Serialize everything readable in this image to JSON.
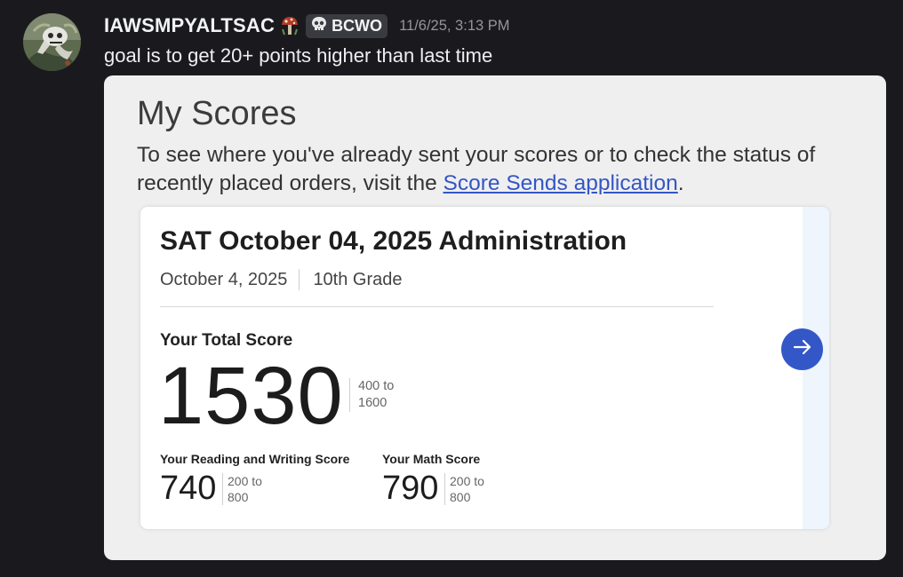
{
  "author": {
    "username": "IAWSMPYALTSAC",
    "role_icon": "mushroom-icon",
    "tag": {
      "icon": "skull-icon",
      "label": "BCWO"
    },
    "timestamp": "11/6/25, 3:13 PM"
  },
  "message": {
    "text": "goal is to get 20+ points higher than last time"
  },
  "embed": {
    "title": "My Scores",
    "description_before": "To see where you've already sent your scores or to check the status of recently placed orders, visit the ",
    "link_text": "Score Sends application",
    "description_after": ".",
    "card": {
      "admin_title": "SAT October 04, 2025 Administration",
      "date": "October 4, 2025",
      "grade": "10th Grade",
      "total_label": "Your Total Score",
      "total_score": "1530",
      "total_range_top": "400 to",
      "total_range_bottom": "1600",
      "rw_label": "Your Reading and Writing Score",
      "rw_score": "740",
      "rw_range_top": "200 to",
      "rw_range_bottom": "800",
      "math_label": "Your Math Score",
      "math_score": "790",
      "math_range_top": "200 to",
      "math_range_bottom": "800",
      "arrow_icon": "arrow-right-icon"
    }
  },
  "colors": {
    "background": "#1a1a1e",
    "embed_bg": "#efefef",
    "link": "#3456c4",
    "accent_button": "#3457c8",
    "card_strip": "#eef5fc"
  }
}
